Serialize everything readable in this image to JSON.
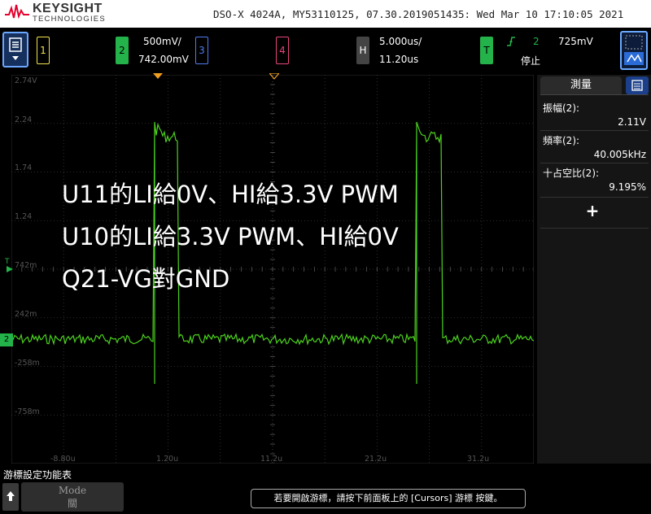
{
  "header": {
    "brand": "KEYSIGHT",
    "brand_sub": "TECHNOLOGIES",
    "model_info": "DSO-X 4024A, MY53110125, 07.30.2019051435: Wed Mar 10 17:10:05 2021"
  },
  "channels": {
    "ch1": {
      "num": "1",
      "color": "#f2e34b"
    },
    "ch2": {
      "num": "2",
      "color": "#24b34a",
      "scale": "500mV/",
      "offset": "742.00mV"
    },
    "ch3": {
      "num": "3",
      "color": "#4f7cf0"
    },
    "ch4": {
      "num": "4",
      "color": "#e8447e"
    }
  },
  "horizontal": {
    "label": "H",
    "scale": "5.000us/",
    "delay": "11.20us"
  },
  "trigger": {
    "label": "T",
    "source": "2",
    "level": "725mV",
    "status": "停止"
  },
  "y_ticks": [
    "2.74V",
    "2.24",
    "1.74",
    "1.24",
    "742m",
    "242m",
    "-258m",
    "-758m"
  ],
  "x_ticks": [
    "-8.80u",
    "1.20u",
    "11.2u",
    "21.2u",
    "31.2u"
  ],
  "overlay_text": [
    "U11的LI給0V、HI給3.3V PWM",
    "U10的LI給3.3V PWM、HI給0V",
    "Q21-VG對GND"
  ],
  "measure": {
    "title": "測量",
    "items": [
      {
        "label": "振幅(2):",
        "value": "2.11V"
      },
      {
        "label": "頻率(2):",
        "value": "40.005kHz"
      },
      {
        "label": "十占空比(2):",
        "value": "9.195%"
      }
    ],
    "add": "+"
  },
  "softkeys": {
    "title": "游標設定功能表",
    "mode_label": "Mode",
    "mode_value": "關"
  },
  "hint": "若要開啟游標，請按下前面板上的 [Cursors] 游標 按鍵。",
  "colors": {
    "trace": "#4cd21e",
    "grid": "#3a3a3a",
    "accent": "#6aa8ff"
  }
}
